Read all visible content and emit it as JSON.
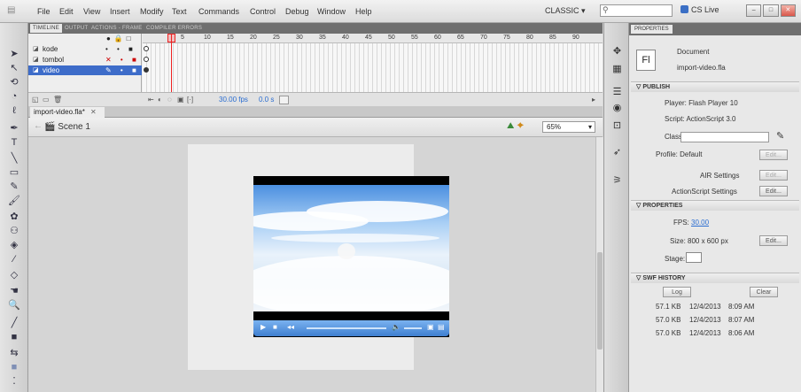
{
  "menu": {
    "items": [
      "File",
      "Edit",
      "View",
      "Insert",
      "Modify",
      "Text",
      "Commands",
      "Control",
      "Debug",
      "Window",
      "Help"
    ],
    "workspace": "CLASSIC ▾",
    "cslive": "CS Live"
  },
  "timeline": {
    "tabs": [
      "TIMELINE",
      "OUTPUT",
      "ACTIONS - FRAME",
      "COMPILER ERRORS"
    ],
    "frame_numbers": [
      "5",
      "10",
      "15",
      "20",
      "25",
      "30",
      "35",
      "40",
      "45",
      "50",
      "55",
      "60",
      "65",
      "70",
      "75",
      "80",
      "85",
      "90"
    ],
    "layers": [
      {
        "name": "kode",
        "flags": "• • ■"
      },
      {
        "name": "tombol",
        "flags": "✕ • ■"
      },
      {
        "name": "video",
        "flags": "✎ • ■"
      }
    ],
    "fps": "30.00 fps",
    "time": "0.0 s"
  },
  "document": {
    "tab": "import-video.fla*",
    "scene": "Scene 1",
    "zoom": "65%"
  },
  "properties": {
    "tab": "PROPERTIES",
    "doc_label": "Document",
    "doc_name": "import-video.fla",
    "doc_icon": "Fl",
    "publish_header": "PUBLISH",
    "player": "Player:  Flash Player 10",
    "script": "Script:  ActionScript 3.0",
    "class_label": "Class:",
    "profile": "Profile:  Default",
    "edit": "Edit...",
    "air_settings": "AIR Settings",
    "as_settings": "ActionScript Settings",
    "properties_header": "PROPERTIES",
    "fps_label": "FPS:",
    "fps_value": "30.00",
    "size": "Size:  800 x 600 px",
    "stage_label": "Stage:",
    "history_header": "SWF HISTORY",
    "log": "Log",
    "clear": "Clear",
    "history": [
      {
        "size": "57.1 KB",
        "date": "12/4/2013",
        "time": "8:09 AM"
      },
      {
        "size": "57.0 KB",
        "date": "12/4/2013",
        "time": "8:07 AM"
      },
      {
        "size": "57.0 KB",
        "date": "12/4/2013",
        "time": "8:06 AM"
      }
    ]
  },
  "colors": {
    "selection_blue": "#3d6cc9",
    "playhead_red": "#e22222",
    "link_blue": "#2a6dd1"
  }
}
